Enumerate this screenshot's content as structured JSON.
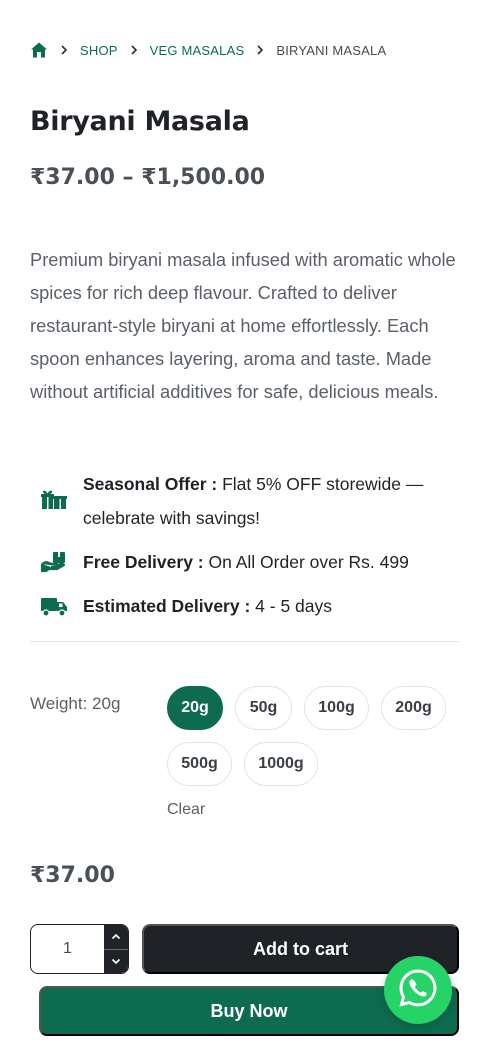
{
  "breadcrumb": {
    "items": [
      {
        "label": "SHOP"
      },
      {
        "label": "VEG MASALAS"
      },
      {
        "label": "BIRYANI MASALA"
      }
    ]
  },
  "product": {
    "title": "Biryani Masala",
    "price_range": "₹37.00 – ₹1,500.00",
    "description": "Premium biryani masala infused with aromatic whole spices for rich deep flavour. Crafted to deliver restaurant-style biryani at home effortlessly. Each spoon enhances layering, aroma and taste. Made without artificial additives for safe, delicious meals."
  },
  "offers": [
    {
      "icon": "gift-icon",
      "label": "Seasonal Offer :",
      "text": " Flat 5% OFF storewide — celebrate with savings!"
    },
    {
      "icon": "delivery-hand-icon",
      "label": "Free Delivery :",
      "text": " On All Order over Rs. 499"
    },
    {
      "icon": "truck-icon",
      "label": "Estimated Delivery :",
      "text": " 4 - 5 days"
    }
  ],
  "variations": {
    "label": "Weight: 20g",
    "options": [
      "20g",
      "50g",
      "100g",
      "200g",
      "500g",
      "1000g"
    ],
    "selected": "20g",
    "clear_label": "Clear"
  },
  "unit_price": "₹37.00",
  "cart": {
    "quantity": "1",
    "add_label": "Add to cart",
    "buy_label": "Buy Now"
  },
  "colors": {
    "brand_green": "#0d6b4f",
    "dark": "#1f2328",
    "whatsapp": "#25d366"
  }
}
